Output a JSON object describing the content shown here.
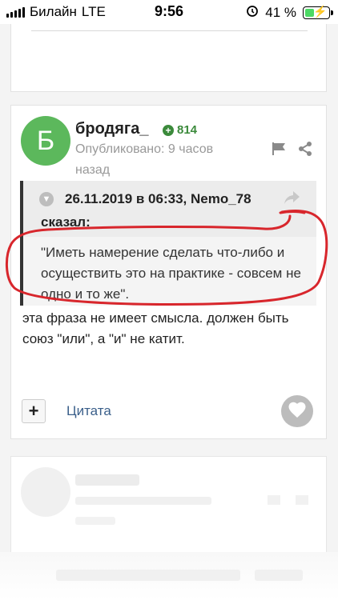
{
  "status_bar": {
    "carrier": "Билайн",
    "network": "LTE",
    "time": "9:56",
    "battery": "41 %",
    "battery_level": 0.41
  },
  "post": {
    "avatar_letter": "Б",
    "avatar_color": "#5cb85c",
    "author": "бродяга_",
    "reputation": "814",
    "published": "Опубликовано: 9 часов назад",
    "quote": {
      "meta": "26.11.2019 в 06:33, Nemo_78",
      "said": "сказал:",
      "text": "\"Иметь намерение сделать что-либо и осуществить это на практике - совсем не одно и то же\"."
    },
    "body": "эта фраза не имеет смысла.  должен быть союз \"или\", а \"и\" не катит.",
    "actions": {
      "plus": "+",
      "quote_label": "Цитата"
    }
  },
  "colors": {
    "annotation": "#d8262c",
    "link": "#3a5f8a",
    "rep": "#3b8a3b"
  }
}
